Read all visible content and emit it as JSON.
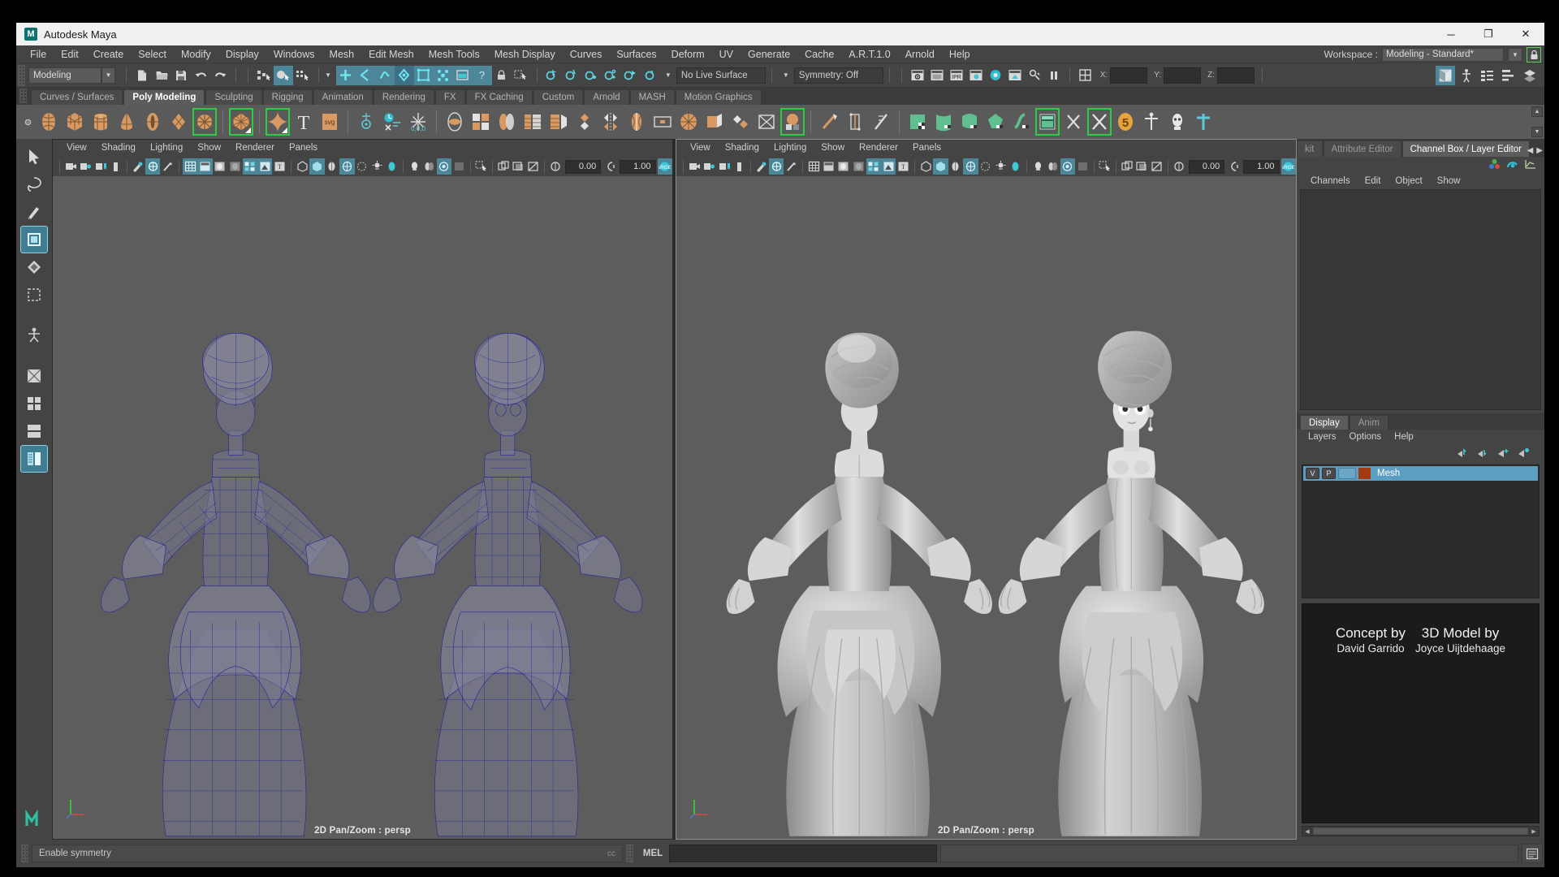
{
  "window": {
    "title": "Autodesk Maya",
    "logo_icon": "maya-logo-icon",
    "minimize_label": "─",
    "maximize_label": "❐",
    "close_label": "✕"
  },
  "menubar": {
    "items": [
      "File",
      "Edit",
      "Create",
      "Select",
      "Modify",
      "Display",
      "Windows",
      "Mesh",
      "Edit Mesh",
      "Mesh Tools",
      "Mesh Display",
      "Curves",
      "Surfaces",
      "Deform",
      "UV",
      "Generate",
      "Cache",
      "A.R.T.1.0",
      "Arnold",
      "Help"
    ],
    "workspace_label": "Workspace :",
    "workspace_value": "Modeling - Standard*",
    "workspace_lock_icon": "lock-icon",
    "workspace_arrow_icon": "chevron-down-icon"
  },
  "statusline": {
    "mode_value": "Modeling",
    "mode_arrow_icon": "chevron-down-icon",
    "live_surface_value": "No Live Surface",
    "symmetry_value": "Symmetry: Off",
    "coord_x_label": "X:",
    "coord_y_label": "Y:",
    "coord_z_label": "Z:",
    "coord_x_value": "",
    "coord_y_value": "",
    "coord_z_value": "",
    "icons": [
      "new-scene-icon",
      "open-scene-icon",
      "save-scene-icon",
      "undo-icon",
      "redo-icon",
      "select-hierarchy-icon",
      "select-object-icon",
      "select-component-icon",
      "snap-grid-icon",
      "snap-curve-icon",
      "snap-point-icon",
      "snap-projected-center-icon",
      "snap-view-plane-icon",
      "snap-orthogonal-icon",
      "make-live-icon",
      "render-current-frame-icon",
      "ipr-render-icon",
      "render-settings-icon",
      "hypershade-icon",
      "render-view-icon",
      "render-sequence-icon",
      "pause-icon",
      "toggle-attribute-editor-icon",
      "toggle-channel-box-icon",
      "toggle-tool-settings-icon",
      "toggle-outliner-icon",
      "modeling-toolkit-icon"
    ]
  },
  "shelf": {
    "tabs": [
      "Curves / Surfaces",
      "Poly Modeling",
      "Sculpting",
      "Rigging",
      "Animation",
      "Rendering",
      "FX",
      "FX Caching",
      "Custom",
      "Arnold",
      "MASH",
      "Motion Graphics"
    ],
    "active_tab": "Poly Modeling",
    "icons": [
      {
        "name": "poly-sphere-icon",
        "color": "#d89a62",
        "highlight": false
      },
      {
        "name": "poly-cube-icon",
        "color": "#d89a62",
        "highlight": false
      },
      {
        "name": "poly-cylinder-icon",
        "color": "#d89a62",
        "highlight": false
      },
      {
        "name": "poly-cone-icon",
        "color": "#d89a62",
        "highlight": false
      },
      {
        "name": "poly-torus-icon",
        "color": "#d89a62",
        "highlight": false
      },
      {
        "name": "poly-plane-icon",
        "color": "#d89a62",
        "highlight": false
      },
      {
        "name": "poly-primitives-icon",
        "color": "#d89a62",
        "highlight": true
      },
      {
        "name": "poly-platonic-icon",
        "color": "#d89a62",
        "highlight": true
      },
      {
        "name": "poly-soft-edge-icon",
        "color": "#d89a62",
        "highlight": true
      },
      {
        "name": "type-tool-icon",
        "color": "#e2e2e2",
        "highlight": false
      },
      {
        "name": "svg-tool-icon",
        "color": "#d89a62",
        "highlight": false
      },
      {
        "name": "center-pivot-icon",
        "color": "#5fc9d8",
        "highlight": false
      },
      {
        "name": "freeze-transform-icon",
        "color": "#5fc9d8",
        "highlight": false
      },
      {
        "name": "reset-transform-icon",
        "color": "#5fc9d8",
        "highlight": false
      },
      {
        "name": "combine-icon",
        "color": "#d89a62",
        "highlight": false
      },
      {
        "name": "separate-icon",
        "color": "#d89a62",
        "highlight": false
      },
      {
        "name": "boolean-icon",
        "color": "#d89a62",
        "highlight": false
      },
      {
        "name": "extrude-icon",
        "color": "#d89a62",
        "highlight": false
      },
      {
        "name": "bevel-icon",
        "color": "#d89a62",
        "highlight": false
      },
      {
        "name": "bridge-icon",
        "color": "#d89a62",
        "highlight": false
      },
      {
        "name": "mirror-icon",
        "color": "#e2e2e2",
        "highlight": false
      },
      {
        "name": "smooth-icon",
        "color": "#d89a62",
        "highlight": false
      },
      {
        "name": "reduce-icon",
        "color": "#d89a62",
        "highlight": false
      },
      {
        "name": "triangulate-icon",
        "color": "#e2e2e2",
        "highlight": false
      },
      {
        "name": "quadrangulate-icon",
        "color": "#d89a62",
        "highlight": false
      },
      {
        "name": "fill-hole-icon",
        "color": "#d89a62",
        "highlight": false
      },
      {
        "name": "sculpt-geometry-icon",
        "color": "#d89a62",
        "highlight": true
      },
      {
        "name": "multi-cut-icon",
        "color": "#d89a62",
        "highlight": false
      },
      {
        "name": "connect-icon",
        "color": "#e2e2e2",
        "highlight": false
      },
      {
        "name": "offset-edge-loop-icon",
        "color": "#d89a62",
        "highlight": false
      },
      {
        "name": "uv-planar-icon",
        "color": "#5fbf8f",
        "highlight": false
      },
      {
        "name": "uv-cylindrical-icon",
        "color": "#5fbf8f",
        "highlight": false
      },
      {
        "name": "uv-spherical-icon",
        "color": "#5fbf8f",
        "highlight": false
      },
      {
        "name": "uv-automatic-icon",
        "color": "#5fbf8f",
        "highlight": false
      },
      {
        "name": "uv-contour-stretch-icon",
        "color": "#5fbf8f",
        "highlight": false
      },
      {
        "name": "uv-editor-icon",
        "color": "#5fbf8f",
        "highlight": true
      },
      {
        "name": "uv-cut-icon",
        "color": "#e2e2e2",
        "highlight": false
      },
      {
        "name": "uv-unfold-icon",
        "color": "#e2e2e2",
        "highlight": true
      },
      {
        "name": "uv-set-5-icon",
        "color": "#e8a33d",
        "highlight": false,
        "label": "5"
      },
      {
        "name": "skeleton-joint-icon",
        "color": "#e2e2e2",
        "highlight": false
      },
      {
        "name": "skin-bind-icon",
        "color": "#e2e2e2",
        "highlight": false
      },
      {
        "name": "rig-control-icon",
        "color": "#5fc9d8",
        "highlight": false
      }
    ],
    "scroll_up_icon": "chevron-up-icon",
    "scroll_down_icon": "chevron-down-icon"
  },
  "toolbox": {
    "items": [
      {
        "name": "select-tool-icon",
        "active": false
      },
      {
        "name": "lasso-tool-icon",
        "active": false
      },
      {
        "name": "paint-select-tool-icon",
        "active": false
      },
      {
        "name": "move-tool-icon",
        "active": true
      },
      {
        "name": "rotate-tool-icon",
        "active": false
      },
      {
        "name": "scale-tool-icon",
        "active": false
      },
      {
        "name": "last-tool-icon",
        "active": false
      },
      {
        "name": "single-perspective-layout-icon",
        "active": false
      },
      {
        "name": "four-view-layout-icon",
        "active": false
      },
      {
        "name": "two-pane-layout-icon",
        "active": false
      },
      {
        "name": "outliner-persp-layout-icon",
        "active": true
      }
    ],
    "maya-logo-bottom-icon": "maya-logo-icon"
  },
  "viewports": [
    {
      "id": "left",
      "menus": [
        "View",
        "Shading",
        "Lighting",
        "Show",
        "Renderer",
        "Panels"
      ],
      "label": "2D Pan/Zoom : persp",
      "field_a": "0.00",
      "field_b": "1.00",
      "shading": "wireframe",
      "active": false,
      "axis_gizmo_icon": "axis-gizmo-icon"
    },
    {
      "id": "right",
      "menus": [
        "View",
        "Shading",
        "Lighting",
        "Show",
        "Renderer",
        "Panels"
      ],
      "label": "2D Pan/Zoom : persp",
      "field_a": "0.00",
      "field_b": "1.00",
      "shading": "smooth-shaded",
      "active": true,
      "axis_gizmo_icon": "axis-gizmo-icon"
    }
  ],
  "right_panel": {
    "tabs": [
      {
        "label": "kit",
        "active": false
      },
      {
        "label": "Attribute Editor",
        "active": false
      },
      {
        "label": "Channel Box / Layer Editor",
        "active": true
      }
    ],
    "nav_prev_icon": "chevron-left-icon",
    "nav_next_icon": "chevron-right-icon",
    "header_icons": [
      "channel-box-icon",
      "anim-layer-icon",
      "graph-editor-icon"
    ],
    "channel_menus": [
      "Channels",
      "Edit",
      "Object",
      "Show"
    ],
    "layer_tabs": [
      {
        "label": "Display",
        "active": true
      },
      {
        "label": "Anim",
        "active": false
      }
    ],
    "layer_menus": [
      "Layers",
      "Options",
      "Help"
    ],
    "layer_buttons": [
      "move-layer-up-icon",
      "move-layer-down-icon",
      "new-layer-icon",
      "new-layer-from-selected-icon"
    ],
    "layers": [
      {
        "visibility": "V",
        "playback": "P",
        "shading": "",
        "color": "#a33a12",
        "name": "Mesh",
        "selected": true
      }
    ],
    "credits": {
      "concept_title": "Concept by",
      "concept_name": "David Garrido",
      "model_title": "3D Model by",
      "model_name": "Joyce Uijtdehaage"
    },
    "scroll_left_icon": "chevron-left-icon",
    "scroll_right_icon": "chevron-right-icon"
  },
  "bottom": {
    "help_text": "Enable symmetry",
    "help_right_ghost": "cc",
    "mel_label": "MEL",
    "command_value": "",
    "script_editor_icon": "script-editor-icon"
  },
  "colors": {
    "accent_blue": "#4d8599",
    "shelf_orange": "#d89a62",
    "shelf_green": "#5fbf8f",
    "highlight_green": "#2ecc40",
    "layer_selected": "#5b9ec1",
    "mesh_layer_color": "#a33a12",
    "wireframe_blue": "#2a2a9e",
    "viewport_bg": "#5d5d5d"
  }
}
